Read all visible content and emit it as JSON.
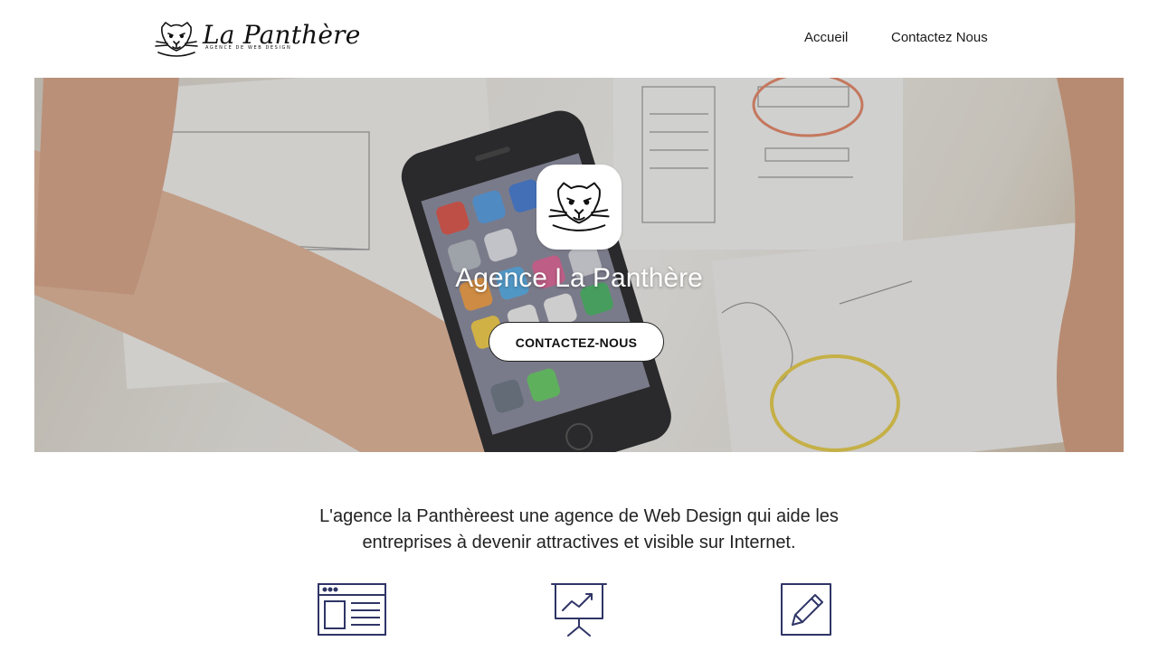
{
  "header": {
    "brand_name": "La Panthère",
    "tagline": "AGENCE DE WEB DESIGN",
    "logo_icon": "panther-head-icon",
    "nav": [
      {
        "label": "Accueil"
      },
      {
        "label": "Contactez Nous"
      }
    ]
  },
  "hero": {
    "title": "Agence La Panthère",
    "cta_label": "CONTACTEZ-NOUS",
    "logo_icon": "panther-head-icon",
    "background": "photo of hands holding a smartphone over paper wireframe sketches"
  },
  "intro": {
    "text": "L'agence la Panthèreest une agence de Web Design qui aide les entreprises à devenir attractives et visible sur Internet."
  },
  "services": {
    "icons": [
      "web-layout-icon",
      "presentation-chart-icon",
      "pencil-edit-icon"
    ],
    "icon_color": "#2f3566"
  },
  "colors": {
    "background": "#ffffff",
    "text": "#1a1a1a",
    "accent": "#2f3566"
  }
}
